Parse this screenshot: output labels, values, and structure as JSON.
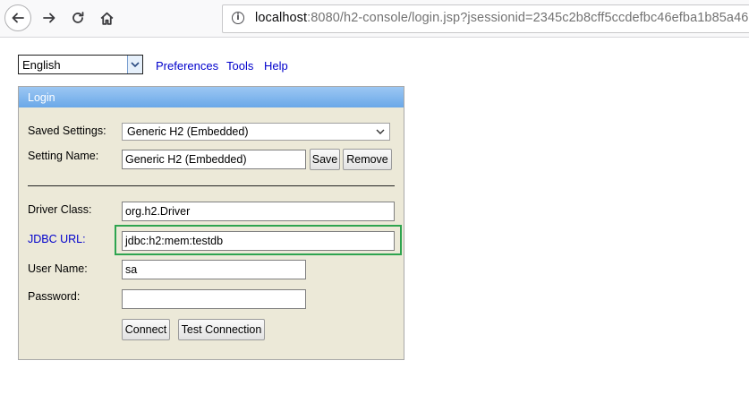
{
  "browser": {
    "url_host": "localhost",
    "url_rest": ":8080/h2-console/login.jsp?jsessionid=2345c2b8cff5ccdefbc46efba1b85a46"
  },
  "topnav": {
    "language": "English",
    "links": [
      "Preferences",
      "Tools",
      "Help"
    ]
  },
  "login": {
    "title": "Login",
    "saved_settings_label": "Saved Settings:",
    "saved_settings_value": "Generic H2 (Embedded)",
    "setting_name_label": "Setting Name:",
    "setting_name_value": "Generic H2 (Embedded)",
    "save_label": "Save",
    "remove_label": "Remove",
    "driver_class_label": "Driver Class:",
    "driver_class_value": "org.h2.Driver",
    "jdbc_url_label": "JDBC URL:",
    "jdbc_url_value": "jdbc:h2:mem:testdb",
    "user_name_label": "User Name:",
    "user_name_value": "sa",
    "password_label": "Password:",
    "password_value": "",
    "connect_label": "Connect",
    "test_connection_label": "Test Connection"
  },
  "colors": {
    "link": "#0000cc",
    "highlight": "#2ea44f",
    "panel_bg": "#ece9d8",
    "title_bar": "#7fb5ec"
  }
}
